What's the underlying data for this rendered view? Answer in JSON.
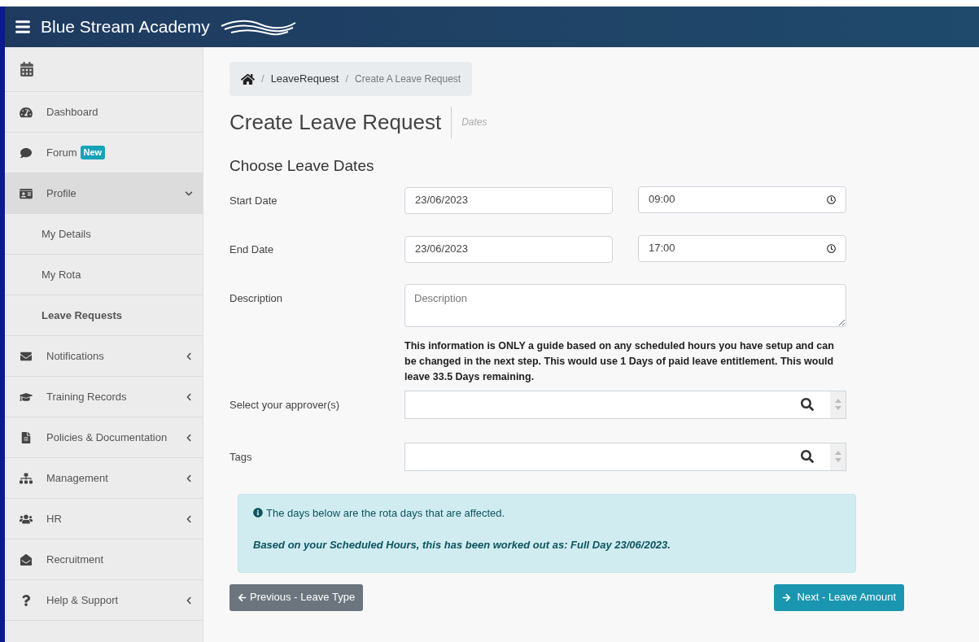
{
  "header": {
    "brand": "Blue Stream Academy"
  },
  "sidebar": {
    "items": [
      {
        "label": "Dashboard",
        "kind": "link"
      },
      {
        "label": "Forum",
        "kind": "link",
        "badge": "New"
      },
      {
        "label": "Profile",
        "kind": "group",
        "expanded": true,
        "children": [
          {
            "label": "My Details",
            "selected": false
          },
          {
            "label": "My Rota",
            "selected": false
          },
          {
            "label": "Leave Requests",
            "selected": true
          }
        ]
      },
      {
        "label": "Notifications",
        "kind": "group",
        "expanded": false
      },
      {
        "label": "Training Records",
        "kind": "group",
        "expanded": false
      },
      {
        "label": "Policies & Documentation",
        "kind": "group",
        "expanded": false
      },
      {
        "label": "Management",
        "kind": "group",
        "expanded": false
      },
      {
        "label": "HR",
        "kind": "group",
        "expanded": false
      },
      {
        "label": "Recruitment",
        "kind": "link"
      },
      {
        "label": "Help & Support",
        "kind": "group",
        "expanded": false
      }
    ]
  },
  "breadcrumb": {
    "separator": "/",
    "items": [
      "LeaveRequest",
      "Create A Leave Request"
    ]
  },
  "page": {
    "title": "Create Leave Request",
    "subtitle": "Dates"
  },
  "form": {
    "heading": "Choose Leave Dates",
    "start": {
      "label": "Start Date",
      "date": "23/06/2023",
      "time": "09:00"
    },
    "end": {
      "label": "End Date",
      "date": "23/06/2023",
      "time": "17:00"
    },
    "description": {
      "label": "Description",
      "placeholder": "Description"
    },
    "guide": "This information is ONLY a guide based on any scheduled hours you have setup and can be changed in the next step. This would use 1 Days of paid leave entitlement. This would leave 33.5 Days remaining.",
    "approvers": {
      "label": "Select your approver(s)"
    },
    "tags": {
      "label": "Tags"
    }
  },
  "alert": {
    "line": "The days below are the rota days that are affected.",
    "summary": "Based on your Scheduled Hours, this has been worked out as: Full Day 23/06/2023."
  },
  "buttons": {
    "previous": "Previous - Leave Type",
    "next": "Next - Leave Amount"
  }
}
